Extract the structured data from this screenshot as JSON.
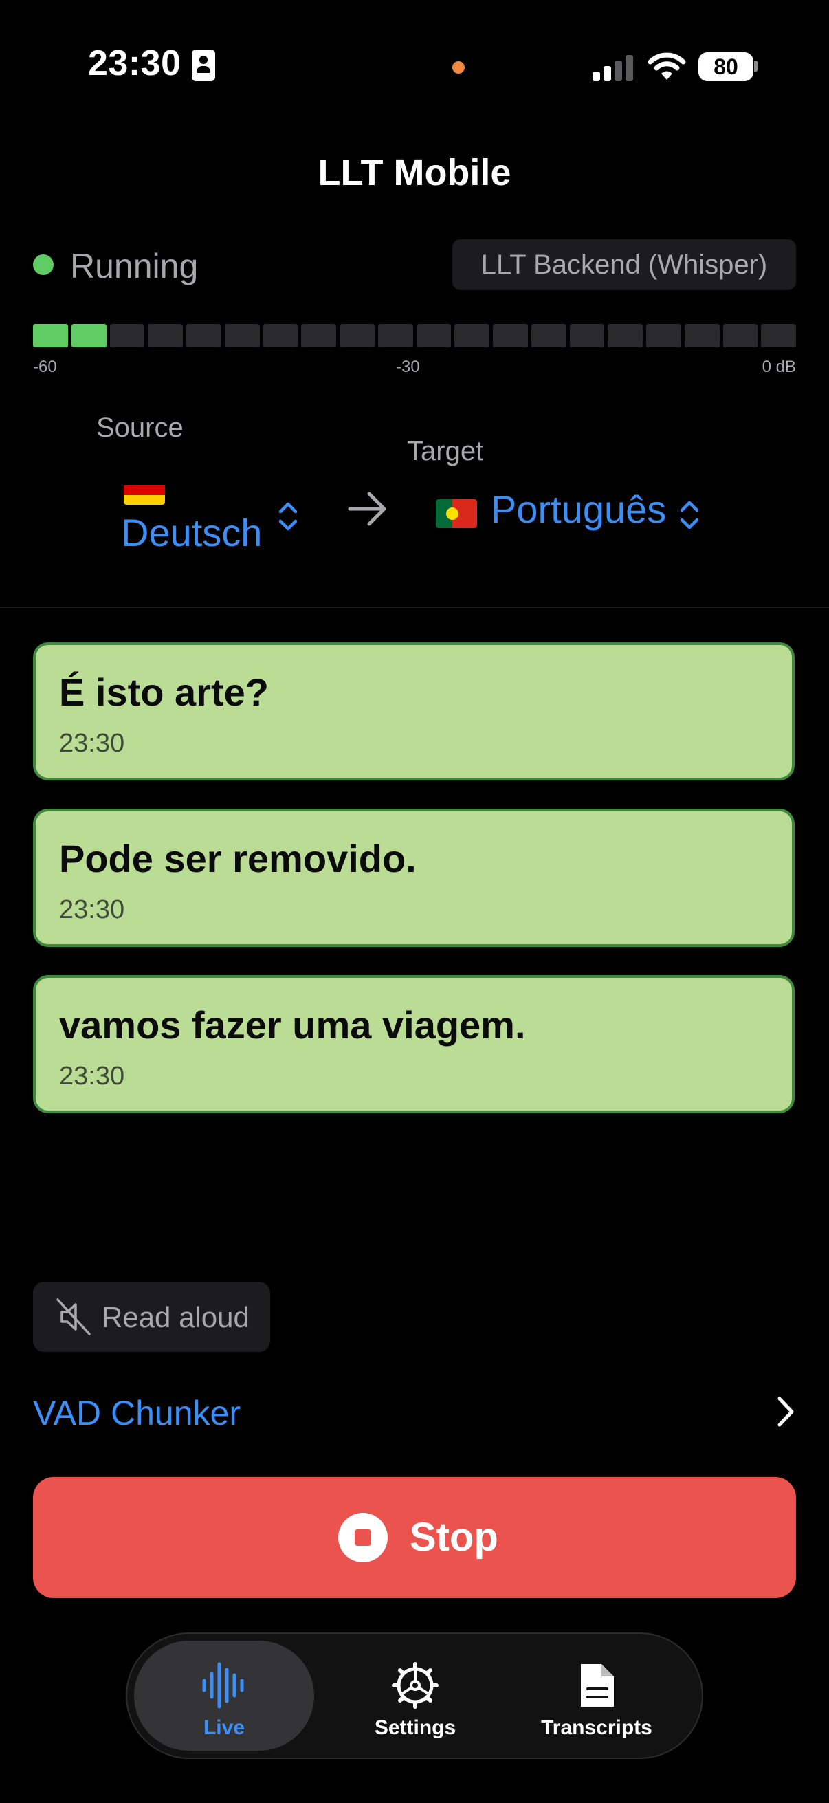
{
  "status_bar": {
    "time": "23:30",
    "battery": "80"
  },
  "app": {
    "title": "LLT Mobile"
  },
  "status": {
    "label": "Running",
    "backend": "LLT Backend (Whisper)"
  },
  "level_meter": {
    "segments_total": 20,
    "segments_active": 2,
    "min_label": "-60",
    "mid_label": "-30",
    "max_label": "0 dB"
  },
  "languages": {
    "source": {
      "caption": "Source",
      "name": "Deutsch",
      "flag": "flag-de-icon"
    },
    "target": {
      "caption": "Target",
      "name": "Português",
      "flag": "flag-pt-icon"
    }
  },
  "transcripts": [
    {
      "text": "É isto arte?",
      "time": "23:30"
    },
    {
      "text": "Pode ser removido.",
      "time": "23:30"
    },
    {
      "text": "vamos fazer uma viagem.",
      "time": "23:30"
    }
  ],
  "read_aloud": {
    "label": "Read aloud",
    "icon": "speaker-muted-icon"
  },
  "chunker": {
    "label": "VAD Chunker"
  },
  "stop_button": {
    "label": "Stop"
  },
  "tabs": [
    {
      "label": "Live",
      "icon": "waveform-icon",
      "active": true
    },
    {
      "label": "Settings",
      "icon": "gear-icon",
      "active": false
    },
    {
      "label": "Transcripts",
      "icon": "document-icon",
      "active": false
    }
  ],
  "colors": {
    "accent": "#3b8ff6",
    "running": "#5ecb63",
    "card_bg": "#badc94",
    "card_border": "#3f8a3e",
    "stop": "#eb534e"
  }
}
